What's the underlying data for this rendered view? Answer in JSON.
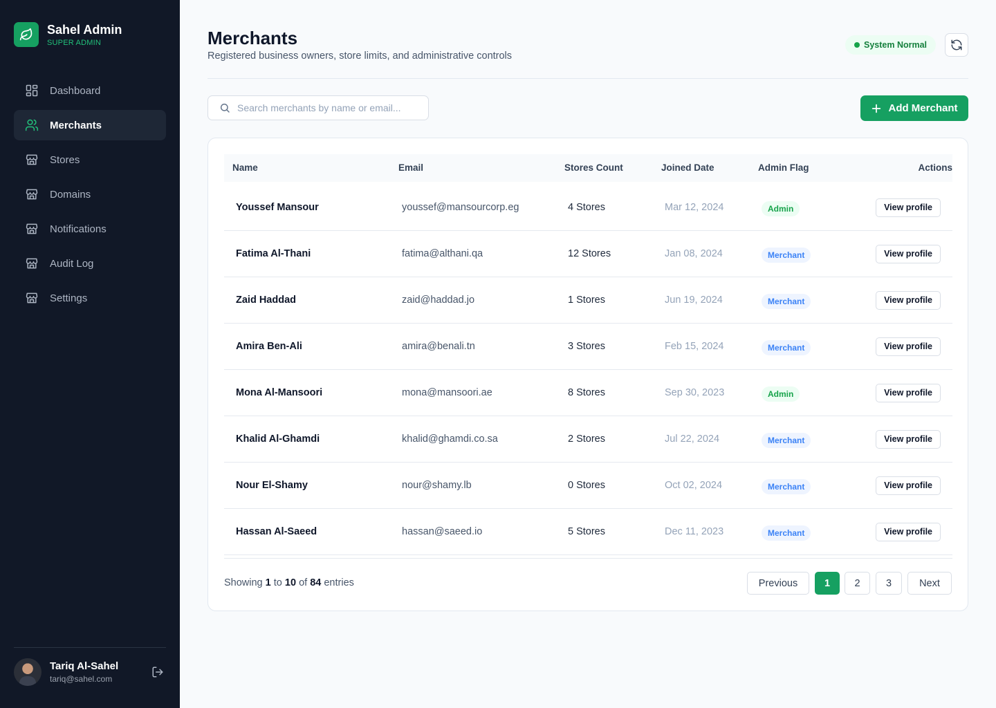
{
  "brand": {
    "name": "Sahel Admin",
    "role": "SUPER ADMIN"
  },
  "nav": [
    {
      "label": "Dashboard",
      "icon": "grid-icon",
      "active": false
    },
    {
      "label": "Merchants",
      "icon": "users-icon",
      "active": true
    },
    {
      "label": "Stores",
      "icon": "store-icon",
      "active": false
    },
    {
      "label": "Domains",
      "icon": "store-icon",
      "active": false
    },
    {
      "label": "Notifications",
      "icon": "store-icon",
      "active": false
    },
    {
      "label": "Audit Log",
      "icon": "store-icon",
      "active": false
    },
    {
      "label": "Settings",
      "icon": "store-icon",
      "active": false
    }
  ],
  "user": {
    "name": "Tariq Al-Sahel",
    "email": "tariq@sahel.com"
  },
  "header": {
    "title": "Merchants",
    "subtitle": "Registered business owners, store limits, and administrative controls",
    "status": "System Normal"
  },
  "search": {
    "placeholder": "Search merchants by name or email..."
  },
  "add_button": "Add Merchant",
  "table": {
    "columns": [
      "Name",
      "Email",
      "Stores Count",
      "Joined Date",
      "Admin Flag",
      "Actions"
    ],
    "rows": [
      {
        "name": "Youssef Mansour",
        "email": "youssef@mansourcorp.eg",
        "stores": "4 Stores",
        "joined": "Mar 12, 2024",
        "flag": "Admin",
        "action": "View profile"
      },
      {
        "name": "Fatima Al-Thani",
        "email": "fatima@althani.qa",
        "stores": "12 Stores",
        "joined": "Jan 08, 2024",
        "flag": "Merchant",
        "action": "View profile"
      },
      {
        "name": "Zaid Haddad",
        "email": "zaid@haddad.jo",
        "stores": "1 Stores",
        "joined": "Jun 19, 2024",
        "flag": "Merchant",
        "action": "View profile"
      },
      {
        "name": "Amira Ben-Ali",
        "email": "amira@benali.tn",
        "stores": "3 Stores",
        "joined": "Feb 15, 2024",
        "flag": "Merchant",
        "action": "View profile"
      },
      {
        "name": "Mona Al-Mansoori",
        "email": "mona@mansoori.ae",
        "stores": "8 Stores",
        "joined": "Sep 30, 2023",
        "flag": "Admin",
        "action": "View profile"
      },
      {
        "name": "Khalid Al-Ghamdi",
        "email": "khalid@ghamdi.co.sa",
        "stores": "2 Stores",
        "joined": "Jul 22, 2024",
        "flag": "Merchant",
        "action": "View profile"
      },
      {
        "name": "Nour El-Shamy",
        "email": "nour@shamy.lb",
        "stores": "0 Stores",
        "joined": "Oct 02, 2024",
        "flag": "Merchant",
        "action": "View profile"
      },
      {
        "name": "Hassan Al-Saeed",
        "email": "hassan@saeed.io",
        "stores": "5 Stores",
        "joined": "Dec 11, 2023",
        "flag": "Merchant",
        "action": "View profile"
      }
    ]
  },
  "pagination": {
    "showing_prefix": "Showing",
    "from": "1",
    "to_word": "to",
    "to": "10",
    "of_word": "of",
    "total": "84",
    "suffix": "entries",
    "previous": "Previous",
    "pages": [
      "1",
      "2",
      "3"
    ],
    "current": "1",
    "next": "Next"
  },
  "colors": {
    "accent": "#16a061",
    "sidebar_bg": "#111827",
    "admin_flag": "#16a34a",
    "merchant_flag": "#3b82f6"
  }
}
